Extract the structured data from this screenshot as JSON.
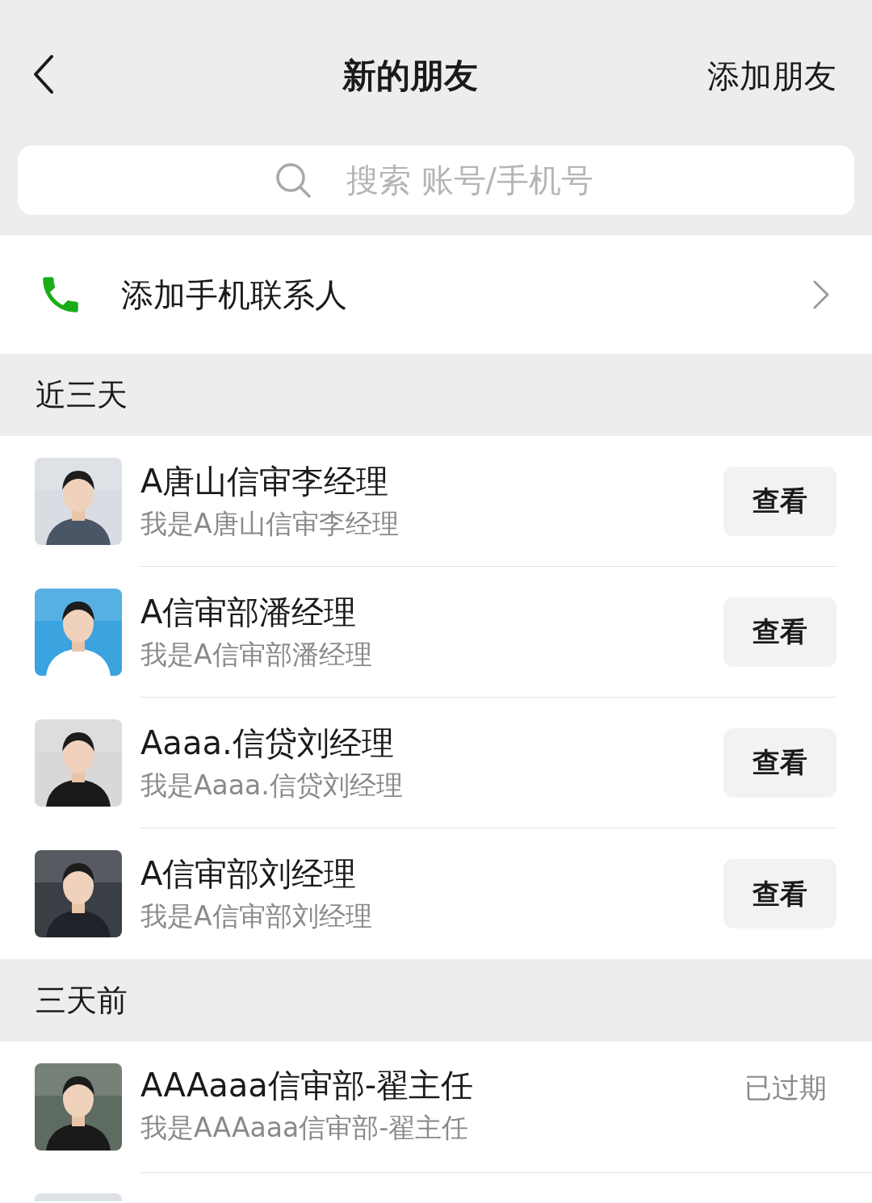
{
  "header": {
    "title": "新的朋友",
    "action": "添加朋友"
  },
  "search": {
    "placeholder": "搜索 账号/手机号"
  },
  "add_contacts": {
    "label": "添加手机联系人"
  },
  "sections": [
    {
      "title": "近三天",
      "items": [
        {
          "name": "A唐山信审李经理",
          "message": "我是A唐山信审李经理",
          "kind": "button",
          "action": "查看"
        },
        {
          "name": "A信审部潘经理",
          "message": "我是A信审部潘经理",
          "kind": "button",
          "action": "查看"
        },
        {
          "name": "Aaaa.信贷刘经理",
          "message": "我是Aaaa.信贷刘经理",
          "kind": "button",
          "action": "查看"
        },
        {
          "name": "A信审部刘经理",
          "message": "我是A信审部刘经理",
          "kind": "button",
          "action": "查看"
        }
      ]
    },
    {
      "title": "三天前",
      "items": [
        {
          "name": "AAAaaa信审部-翟主任",
          "message": "我是AAAaaa信审部-翟主任",
          "kind": "status",
          "action": "已过期"
        }
      ]
    }
  ]
}
